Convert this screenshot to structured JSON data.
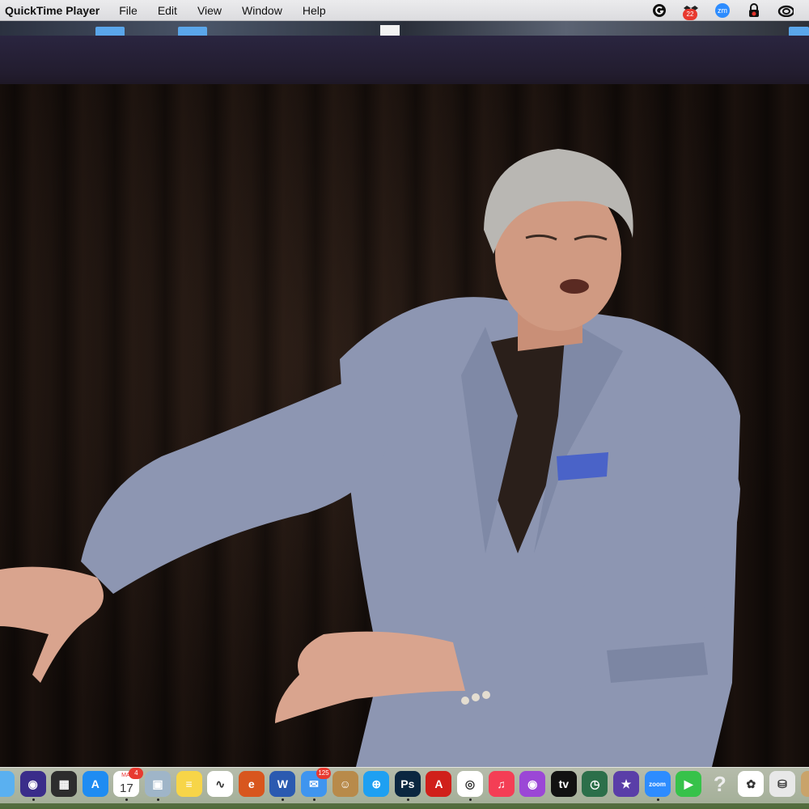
{
  "menubar": {
    "app_name": "QuickTime Player",
    "items": [
      "File",
      "Edit",
      "View",
      "Window",
      "Help"
    ],
    "status_icons": [
      {
        "name": "grammarly-icon"
      },
      {
        "name": "dropbox-icon",
        "badge": "22"
      },
      {
        "name": "zoom-icon",
        "label": "zm"
      },
      {
        "name": "lock-icon"
      },
      {
        "name": "creative-cloud-icon"
      }
    ]
  },
  "dock": {
    "icons": [
      {
        "name": "finder-icon",
        "color": "#5ab0f0",
        "glyph": ""
      },
      {
        "name": "siri-icon",
        "color": "#3a2d8a",
        "glyph": "◉"
      },
      {
        "name": "launchpad-icon",
        "color": "#2d2d2d",
        "glyph": "▦"
      },
      {
        "name": "app-store-icon",
        "color": "#1f8cf2",
        "glyph": "A"
      },
      {
        "name": "calendar-icon",
        "color": "#ffffff",
        "glyph": "17",
        "month": "MAI",
        "badge": "4"
      },
      {
        "name": "preview-icon",
        "color": "#9fb5c8",
        "glyph": "▣"
      },
      {
        "name": "notes-icon",
        "color": "#f7d548",
        "glyph": "≡"
      },
      {
        "name": "freeform-icon",
        "color": "#ffffff",
        "glyph": "∿"
      },
      {
        "name": "app-e-icon",
        "color": "#d8561e",
        "glyph": "e"
      },
      {
        "name": "word-icon",
        "color": "#2b5ab0",
        "glyph": "W"
      },
      {
        "name": "mail-icon",
        "color": "#3f95ef",
        "glyph": "✉",
        "badge": "125"
      },
      {
        "name": "contacts-icon",
        "color": "#b88a4a",
        "glyph": "☺"
      },
      {
        "name": "safari-icon",
        "color": "#1ea0f2",
        "glyph": "⊕"
      },
      {
        "name": "photoshop-icon",
        "color": "#0b2740",
        "glyph": "Ps"
      },
      {
        "name": "acrobat-icon",
        "color": "#d0201a",
        "glyph": "A"
      },
      {
        "name": "chrome-icon",
        "color": "#ffffff",
        "glyph": "◎"
      },
      {
        "name": "music-icon",
        "color": "#f43e55",
        "glyph": "♫"
      },
      {
        "name": "podcasts-icon",
        "color": "#9b47d6",
        "glyph": "◉"
      },
      {
        "name": "apple-tv-icon",
        "color": "#111111",
        "glyph": "tv"
      },
      {
        "name": "time-machine-icon",
        "color": "#2c6f4a",
        "glyph": "◷"
      },
      {
        "name": "imovie-icon",
        "color": "#5a3ea8",
        "glyph": "★"
      },
      {
        "name": "zoom-app-icon",
        "color": "#2d8cff",
        "glyph": "zoom"
      },
      {
        "name": "facetime-icon",
        "color": "#37c24a",
        "glyph": "▶"
      },
      {
        "name": "unknown-app-icon",
        "color": "transparent",
        "glyph": "?"
      },
      {
        "name": "photos-icon",
        "color": "#ffffff",
        "glyph": "✿"
      },
      {
        "name": "disk-utility-icon",
        "color": "#e8e8e8",
        "glyph": "⛁"
      },
      {
        "name": "folder-stack-icon",
        "color": "#c9a36a",
        "glyph": ""
      }
    ],
    "running": [
      1,
      4,
      5,
      9,
      10,
      13,
      15,
      21
    ]
  }
}
